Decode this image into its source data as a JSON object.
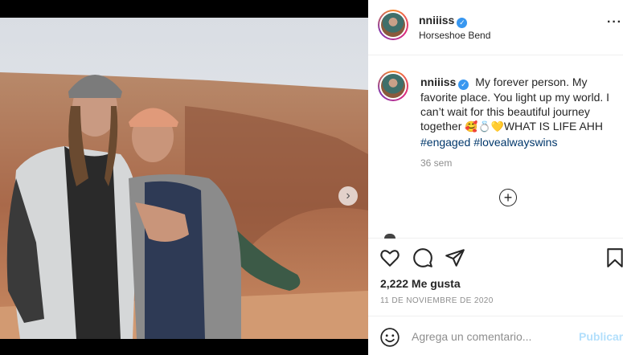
{
  "post": {
    "username": "nniiiss",
    "location": "Horseshoe Bend",
    "caption": {
      "text": "My forever person. My favorite place. You light up my world. I can’t wait for this beautiful journey together",
      "emojis": "🥰💍💛",
      "tail": "WHAT IS LIFE AHH",
      "hashtags": [
        "#engaged",
        "#lovealwayswins"
      ]
    },
    "time_ago": "36 sem",
    "likes": "2,222 Me gusta",
    "date": "11 DE NOVIEMBRE DE 2020",
    "carousel": {
      "slides": 2,
      "active_index": 0
    }
  },
  "icons": {
    "verified": "verified-badge-icon",
    "more": "more-options-icon",
    "like": "heart-icon",
    "comment": "comment-icon",
    "share": "paper-plane-icon",
    "save": "bookmark-icon",
    "load_more": "plus-circle-icon",
    "emoji": "smile-icon",
    "next": "chevron-right-icon"
  },
  "comment_box": {
    "placeholder": "Agrega un comentario...",
    "post_label": "Publicar"
  },
  "colors": {
    "verified": "#3897f0",
    "hashtag": "#00376b",
    "publish_disabled": "#b2dffc",
    "muted": "#8e8e8e"
  }
}
